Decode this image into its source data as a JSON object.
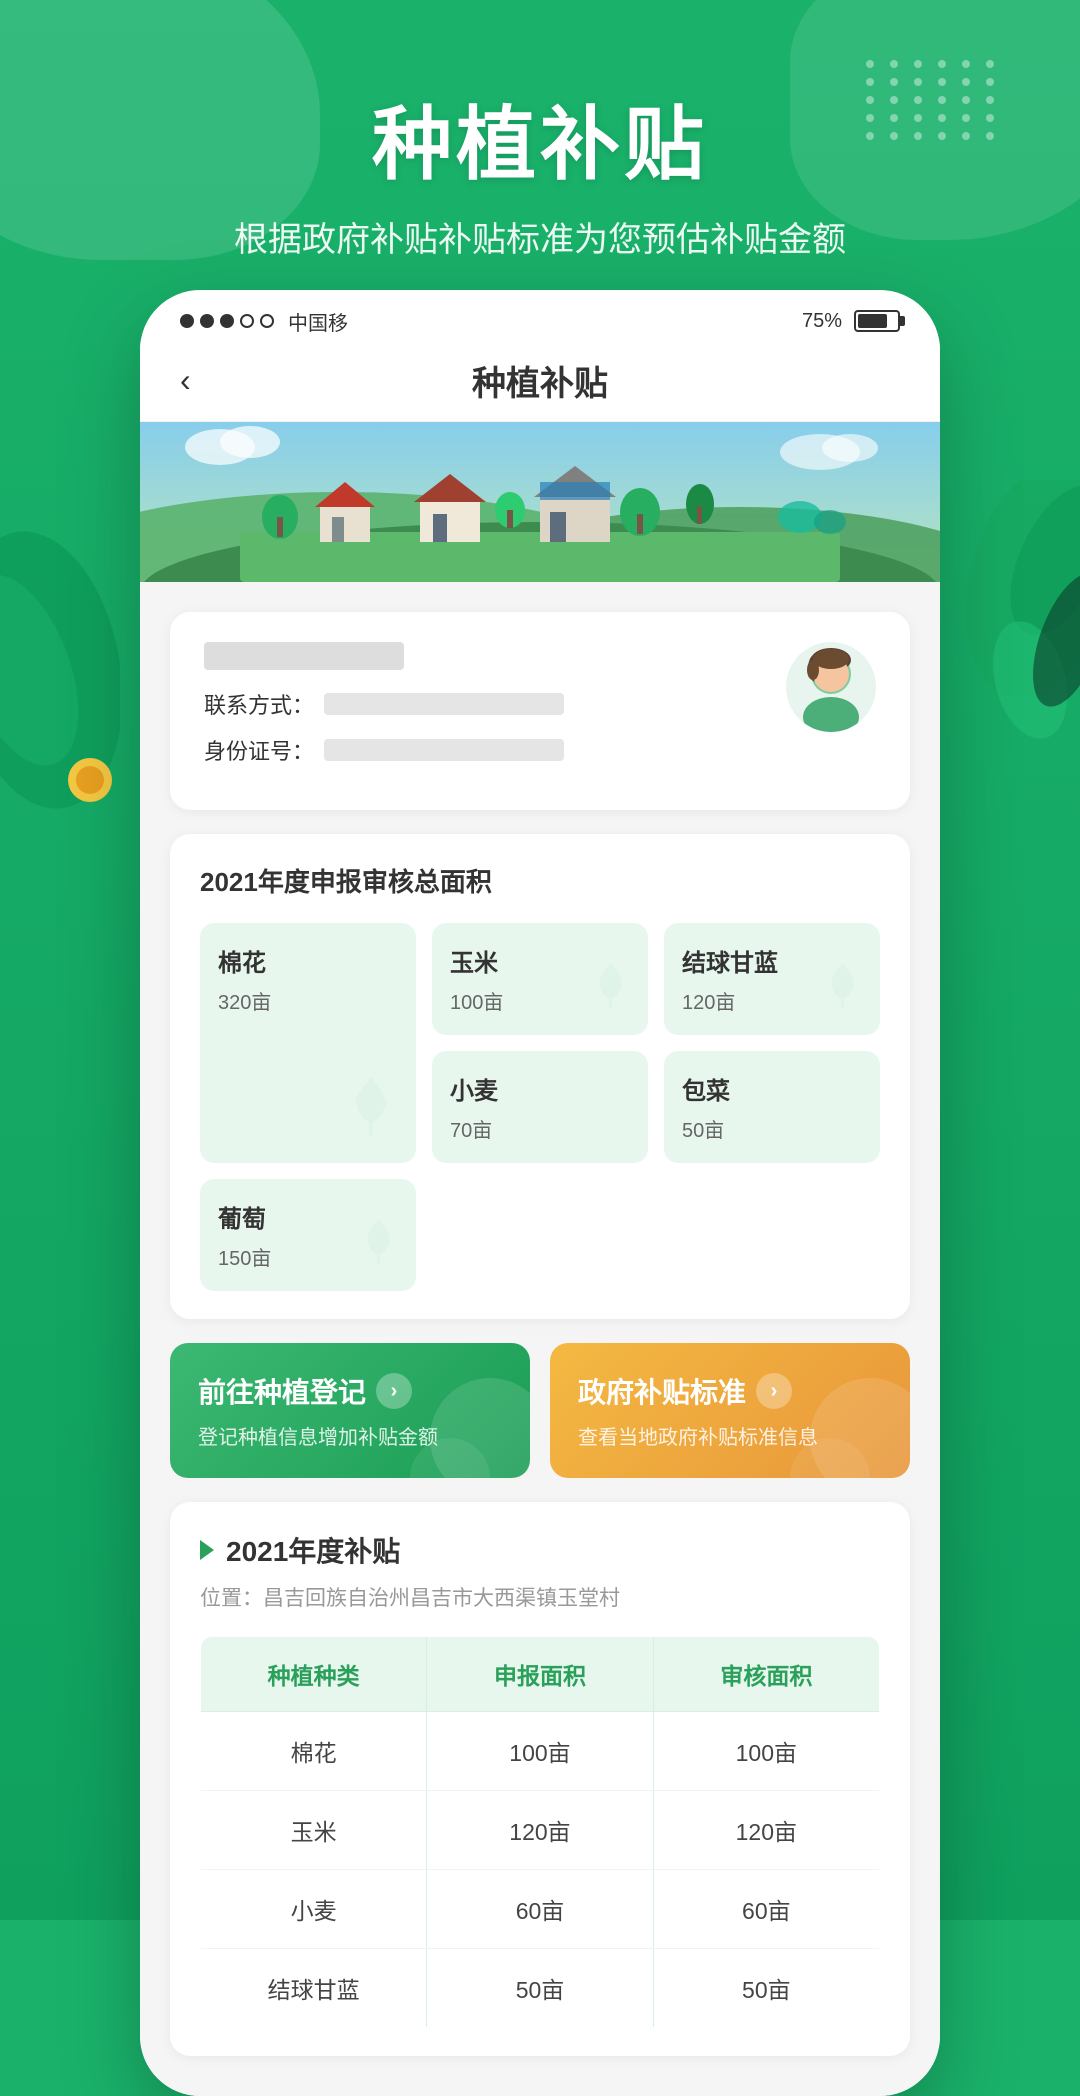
{
  "app": {
    "main_title": "种植补贴",
    "sub_title": "根据政府补贴补贴标准为您预估补贴金额"
  },
  "status_bar": {
    "carrier": "中国移",
    "battery_pct": "75%"
  },
  "nav": {
    "back_icon": "‹",
    "title": "种植补贴"
  },
  "user_card": {
    "contact_label": "联系方式：",
    "id_label": "身份证号："
  },
  "stats": {
    "section_title": "2021年度申报审核总面积",
    "crops": [
      {
        "name": "棉花",
        "area": "320亩",
        "span": "tall"
      },
      {
        "name": "玉米",
        "area": "100亩"
      },
      {
        "name": "结球甘蓝",
        "area": "120亩"
      },
      {
        "name": "小麦",
        "area": "70亩"
      },
      {
        "name": "包菜",
        "area": "50亩"
      },
      {
        "name": "葡萄",
        "area": "150亩"
      }
    ]
  },
  "actions": {
    "register": {
      "title": "前往种植登记",
      "desc": "登记种植信息增加补贴金额",
      "arrow": "›"
    },
    "standard": {
      "title": "政府补贴标准",
      "desc": "查看当地政府补贴标准信息",
      "arrow": "›"
    }
  },
  "subsidy": {
    "year_label": "2021年度补贴",
    "location_label": "位置：昌吉回族自治州昌吉市大西渠镇玉堂村",
    "table": {
      "headers": [
        "种植种类",
        "申报面积",
        "审核面积"
      ],
      "rows": [
        [
          "棉花",
          "100亩",
          "100亩"
        ],
        [
          "玉米",
          "120亩",
          "120亩"
        ],
        [
          "小麦",
          "60亩",
          "60亩"
        ],
        [
          "结球甘蓝",
          "50亩",
          "50亩"
        ]
      ]
    }
  },
  "colors": {
    "primary_green": "#1ab26b",
    "light_green": "#e8f7ee",
    "orange": "#f4b942",
    "text_dark": "#333333",
    "text_gray": "#999999"
  }
}
